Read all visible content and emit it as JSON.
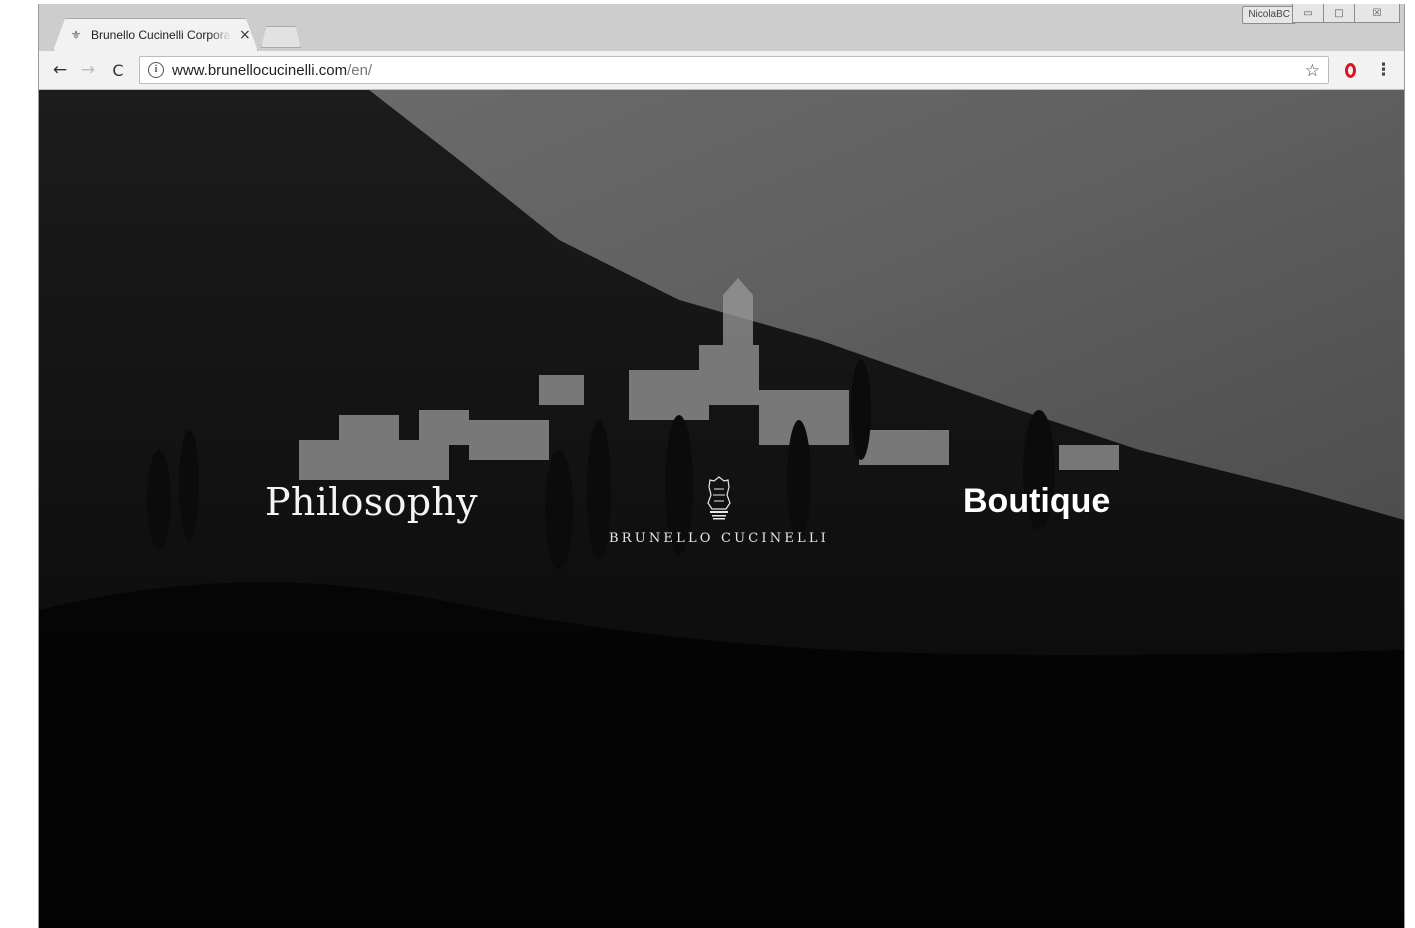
{
  "browser": {
    "tab_title": "Brunello Cucinelli Corporate",
    "tab_close": "×",
    "profile_name": "NicolaBC",
    "url_host": "www.brunellocucinelli.com",
    "url_path": "/en/",
    "back_icon": "←",
    "forward_icon": "→",
    "reload_icon": "C",
    "info_icon": "i",
    "star_icon": "☆",
    "menu_icon": "⋮",
    "minimize_icon": "▭",
    "maximize_icon": "□",
    "close_icon": "☒",
    "favicon": "⚜"
  },
  "page": {
    "nav_left": "Philosophy",
    "nav_right": "Boutique",
    "brand_name": "BRUNELLO CUCINELLI"
  },
  "colors": {
    "opera_red": "#e0111b",
    "hero_text": "#ffffff"
  }
}
